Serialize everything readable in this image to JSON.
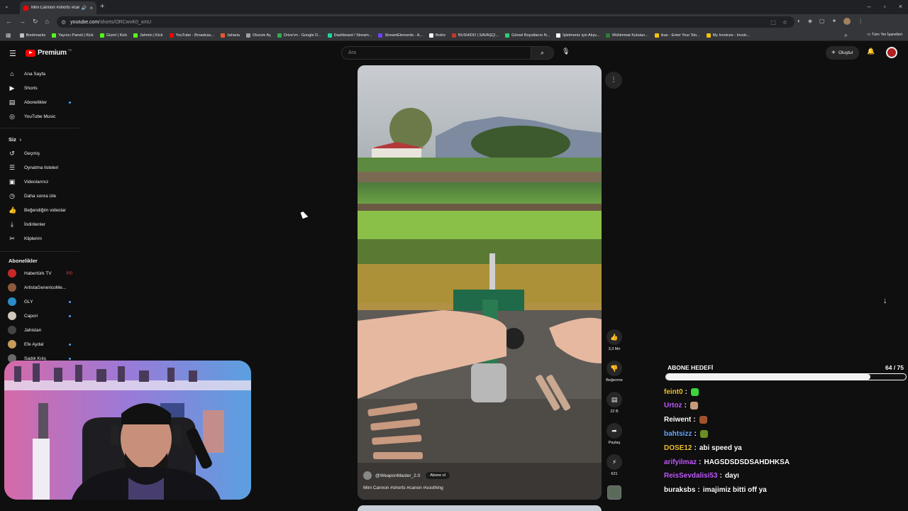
{
  "browser": {
    "tab_title": "Mini Cannon #shorts #cano",
    "url_domain": "youtube.com",
    "url_path": "/shorts/ORCwvK0_xmU",
    "bookmarks": [
      {
        "label": "Bookmarks",
        "color": "#bdc1c6"
      },
      {
        "label": "Yayıncı Paneli | Kick",
        "color": "#53fc18"
      },
      {
        "label": "Güzel | Kick",
        "color": "#53fc18"
      },
      {
        "label": "Jahmin | Kick",
        "color": "#53fc18"
      },
      {
        "label": "YouTube - Broadcas...",
        "color": "#ff0000"
      },
      {
        "label": "Jaharia",
        "color": "#e85a2a"
      },
      {
        "label": "Oturum Aç",
        "color": "#9aa0a6"
      },
      {
        "label": "Drive'ım - Google D...",
        "color": "#34a853"
      },
      {
        "label": "Dashboard / Stream...",
        "color": "#1fd39b"
      },
      {
        "label": "StreamElements - A...",
        "color": "#6f42ff"
      },
      {
        "label": "Botrix",
        "color": "#ffffff"
      },
      {
        "label": "BUSHIDO | SAVAŞÇI...",
        "color": "#c0392b"
      },
      {
        "label": "Görsel Boyutlarını N...",
        "color": "#2ecc71"
      },
      {
        "label": "İşletmeniz için Alışv...",
        "color": "#ffffff"
      },
      {
        "label": "Mühimmat Kutuları...",
        "color": "#2e7d32"
      },
      {
        "label": "ikas - Enter Your Sto...",
        "color": "#f4c20d"
      },
      {
        "label": "My Invoices - Invoic...",
        "color": "#f4c20d"
      }
    ],
    "bookmarks_right": "Tüm Yer İşaretleri"
  },
  "header": {
    "logo_text": "Premium",
    "logo_country": "TR",
    "search_placeholder": "Ara",
    "create_label": "Oluştur"
  },
  "sidebar": {
    "main": [
      {
        "label": "Ana Sayfa",
        "icon": "home-icon",
        "glyph": "⌂"
      },
      {
        "label": "Shorts",
        "icon": "shorts-icon",
        "glyph": "▶"
      },
      {
        "label": "Abonelikler",
        "icon": "subscriptions-icon",
        "glyph": "▤",
        "dot": true
      },
      {
        "label": "YouTube Music",
        "icon": "music-icon",
        "glyph": "◎"
      }
    ],
    "you_heading": "Siz",
    "you": [
      {
        "label": "Geçmiş",
        "icon": "history-icon",
        "glyph": "↺"
      },
      {
        "label": "Oynatma listeleri",
        "icon": "playlists-icon",
        "glyph": "☰"
      },
      {
        "label": "Videolarınız",
        "icon": "your-videos-icon",
        "glyph": "▣"
      },
      {
        "label": "Daha sonra izle",
        "icon": "watch-later-icon",
        "glyph": "◷"
      },
      {
        "label": "Beğendiğim videolar",
        "icon": "liked-icon",
        "glyph": "👍"
      },
      {
        "label": "İndirilenler",
        "icon": "downloads-icon",
        "glyph": "⤓"
      },
      {
        "label": "Kliplerim",
        "icon": "clips-icon",
        "glyph": "✂"
      }
    ],
    "subs_heading": "Abonelikler",
    "subs": [
      {
        "label": "Habertürk TV",
        "color": "#c62828",
        "live": true
      },
      {
        "label": "ArtistaGenericoMe...",
        "color": "#8e5a3c"
      },
      {
        "label": "GLY",
        "color": "#2a8cc8",
        "dot": true
      },
      {
        "label": "Capori",
        "color": "#d0c8b8",
        "dot": true
      },
      {
        "label": "Jahistan",
        "color": "#444444"
      },
      {
        "label": "Efe Aydal",
        "color": "#c79a5a",
        "dot": true
      },
      {
        "label": "Sadık Kılıç",
        "color": "#6a6a6a",
        "dot": true
      }
    ]
  },
  "short": {
    "channel": "@WeaponMaster_2.0",
    "subscribe_label": "Abone ol",
    "title": "Mini Cannon #shorts #canon #soothing",
    "likes": "3,3 Mn",
    "dislike_label": "Beğenme",
    "comments": "22 B",
    "share_label": "Paylaş",
    "remix": "621"
  },
  "overlay": {
    "goal_label": "ABONE HEDEFİ",
    "goal_count": "64 / 75",
    "goal_fraction": 0.853,
    "chat": [
      {
        "user": "feint0",
        "color": "#f2c230",
        "text": "",
        "emote": "#3bd43b"
      },
      {
        "user": "Urtoz",
        "color": "#c45cff",
        "text": "",
        "emote": "#c89a7a"
      },
      {
        "user": "Reiwent",
        "color": "#ffffff",
        "text": "",
        "emote": "#a0522d"
      },
      {
        "user": "bahtsizz",
        "color": "#6aa8ff",
        "text": "",
        "emote": "#6b8e23"
      },
      {
        "user": "DOSE12",
        "color": "#f2c230",
        "text": "abi speed ya"
      },
      {
        "user": "arifyilmaz",
        "color": "#c45cff",
        "text": "HAGSDSDSDSAHDHKSA"
      },
      {
        "user": "ReisSevdalisi53",
        "color": "#c45cff",
        "text": "dayı"
      },
      {
        "user": "buraksbs",
        "color": "#ffffff",
        "text": "imajimiz bitti off ya"
      }
    ]
  }
}
